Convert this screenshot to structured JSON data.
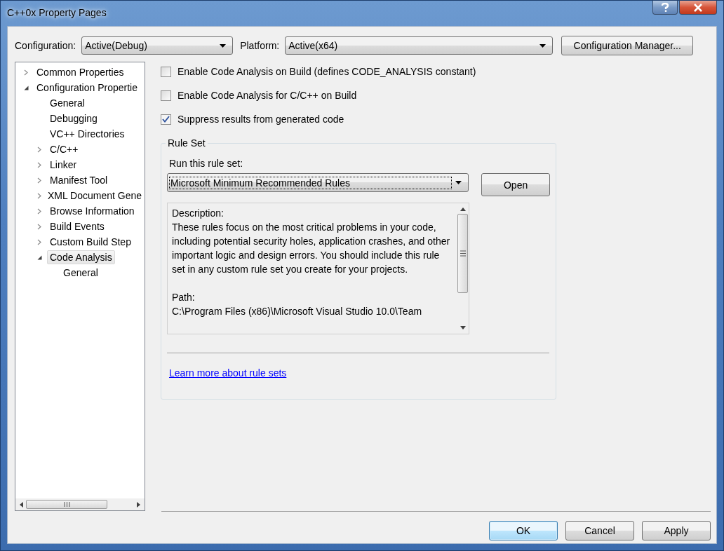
{
  "window": {
    "title": "C++0x Property Pages"
  },
  "configuration": {
    "label": "Configuration:",
    "value": "Active(Debug)"
  },
  "platform": {
    "label": "Platform:",
    "value": "Active(x64)"
  },
  "configuration_manager_button": "Configuration Manager...",
  "tree": [
    {
      "label": "Common Properties",
      "expanded": false,
      "selected": false
    },
    {
      "label": "Configuration Propertie",
      "expanded": true,
      "selected": false,
      "children": [
        {
          "label": "General",
          "selected": false
        },
        {
          "label": "Debugging",
          "selected": false
        },
        {
          "label": "VC++ Directories",
          "selected": false
        },
        {
          "label": "C/C++",
          "expanded": false,
          "selected": false
        },
        {
          "label": "Linker",
          "expanded": false,
          "selected": false
        },
        {
          "label": "Manifest Tool",
          "expanded": false,
          "selected": false
        },
        {
          "label": "XML Document Gene",
          "expanded": false,
          "selected": false
        },
        {
          "label": "Browse Information",
          "expanded": false,
          "selected": false
        },
        {
          "label": "Build Events",
          "expanded": false,
          "selected": false
        },
        {
          "label": "Custom Build Step",
          "expanded": false,
          "selected": false
        },
        {
          "label": "Code Analysis",
          "expanded": true,
          "selected": true,
          "children": [
            {
              "label": "General",
              "selected": false
            }
          ]
        }
      ]
    }
  ],
  "checkboxes": [
    {
      "label": "Enable Code Analysis on Build (defines CODE_ANALYSIS constant)",
      "checked": false
    },
    {
      "label": "Enable Code Analysis for C/C++ on Build",
      "checked": false
    },
    {
      "label": "Suppress results from generated code",
      "checked": true
    }
  ],
  "rule_set": {
    "title": "Rule Set",
    "run_label": "Run this rule set:",
    "value": "Microsoft Minimum Recommended Rules",
    "open_button": "Open",
    "description_label": "Description:",
    "description": "These rules focus on the most critical problems in your code, including potential security holes, application crashes, and other important logic and design errors. You should include this rule set in any custom rule set you create for your projects.",
    "path_label": "Path:",
    "path": "C:\\Program Files (x86)\\Microsoft Visual Studio 10.0\\Team",
    "link": "Learn more about rule sets"
  },
  "buttons": [
    {
      "label": "OK",
      "default": true
    },
    {
      "label": "Cancel",
      "default": false
    },
    {
      "label": "Apply",
      "default": false
    }
  ]
}
